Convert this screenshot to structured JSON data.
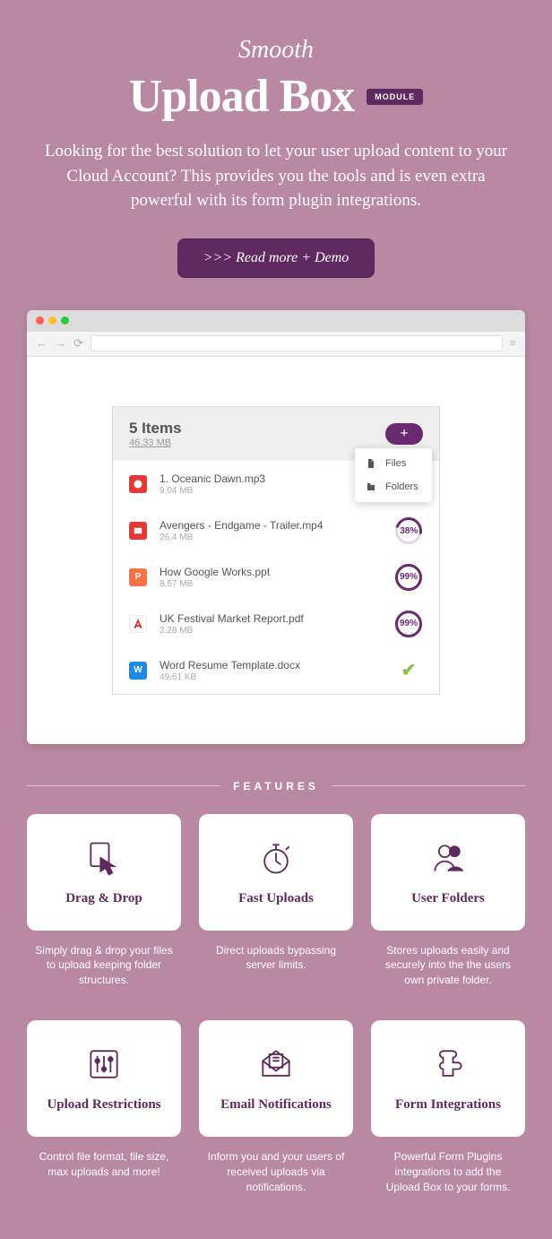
{
  "header": {
    "eyebrow": "Smooth",
    "title": "Upload Box",
    "badge": "MODULE",
    "description": "Looking for the best solution to let your user upload content to your Cloud Account? This provides you the tools and is even extra powerful with its form plugin integrations.",
    "button": ">>> Read more + Demo"
  },
  "panel": {
    "count": "5 Items",
    "total_size": "46.33 MB",
    "dropdown": {
      "files": "Files",
      "folders": "Folders"
    },
    "items": [
      {
        "name": "1. Oceanic Dawn.mp3",
        "size": "9.04 MB",
        "icon_bg": "#e53935",
        "icon_txt": "♫",
        "status": "hidden"
      },
      {
        "name": "Avengers - Endgame - Trailer.mp4",
        "size": "26.4 MB",
        "icon_bg": "#e53935",
        "icon_txt": "▮",
        "status": "38%"
      },
      {
        "name": "How Google Works.ppt",
        "size": "8.57 MB",
        "icon_bg": "#ff7043",
        "icon_txt": "P",
        "status": "99%"
      },
      {
        "name": "UK Festival Market Report.pdf",
        "size": "2.28 MB",
        "icon_bg": "#ffffff",
        "icon_txt": "",
        "status": "99%"
      },
      {
        "name": "Word Resume Template.docx",
        "size": "49.61 KB",
        "icon_bg": "#1e88e5",
        "icon_txt": "W",
        "status": "done"
      }
    ]
  },
  "features_label": "FEATURES",
  "features": [
    {
      "title": "Drag & Drop",
      "desc": "Simply drag & drop your files to upload keeping folder structures."
    },
    {
      "title": "Fast Uploads",
      "desc": "Direct uploads bypassing server limits."
    },
    {
      "title": "User Folders",
      "desc": "Stores uploads easily and securely into the the users own private folder."
    },
    {
      "title": "Upload Restrictions",
      "desc": "Control file format, file size, max uploads and more!"
    },
    {
      "title": "Email Notifications",
      "desc": "Inform you and your users of received uploads via notifications."
    },
    {
      "title": "Form Integrations",
      "desc": "Powerful Form Plugins integrations to add the Upload Box to your forms."
    }
  ]
}
